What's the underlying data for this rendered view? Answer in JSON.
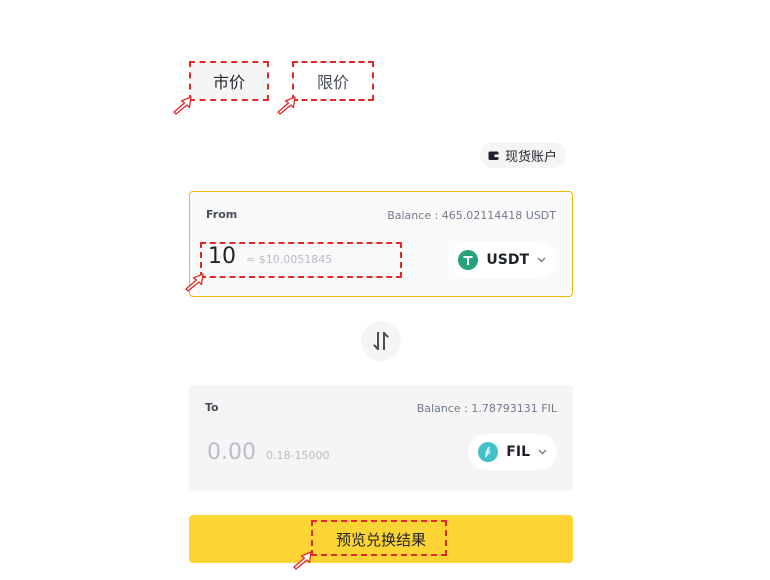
{
  "tabs": {
    "market": "市价",
    "limit": "限价"
  },
  "spot_account": {
    "label": "现货账户",
    "icon": "wallet-icon"
  },
  "from": {
    "label": "From",
    "balance": "Balance : 465.02114418 USDT",
    "amount": "10",
    "usd_estimate": "≈ $10.0051845",
    "coin": "USDT",
    "coin_color": "#26a17b"
  },
  "swap": {
    "icon": "swap-arrows-icon"
  },
  "to": {
    "label": "To",
    "balance": "Balance : 1.78793131 FIL",
    "amount_placeholder": "0.00",
    "range": "0.18-15000",
    "coin": "FIL",
    "coin_color": "#42c1ca"
  },
  "preview_button": {
    "label": "预览兑换结果"
  },
  "colors": {
    "accent": "#fcd535",
    "highlight": "#e02a2a",
    "border_active": "#f0b90b"
  }
}
